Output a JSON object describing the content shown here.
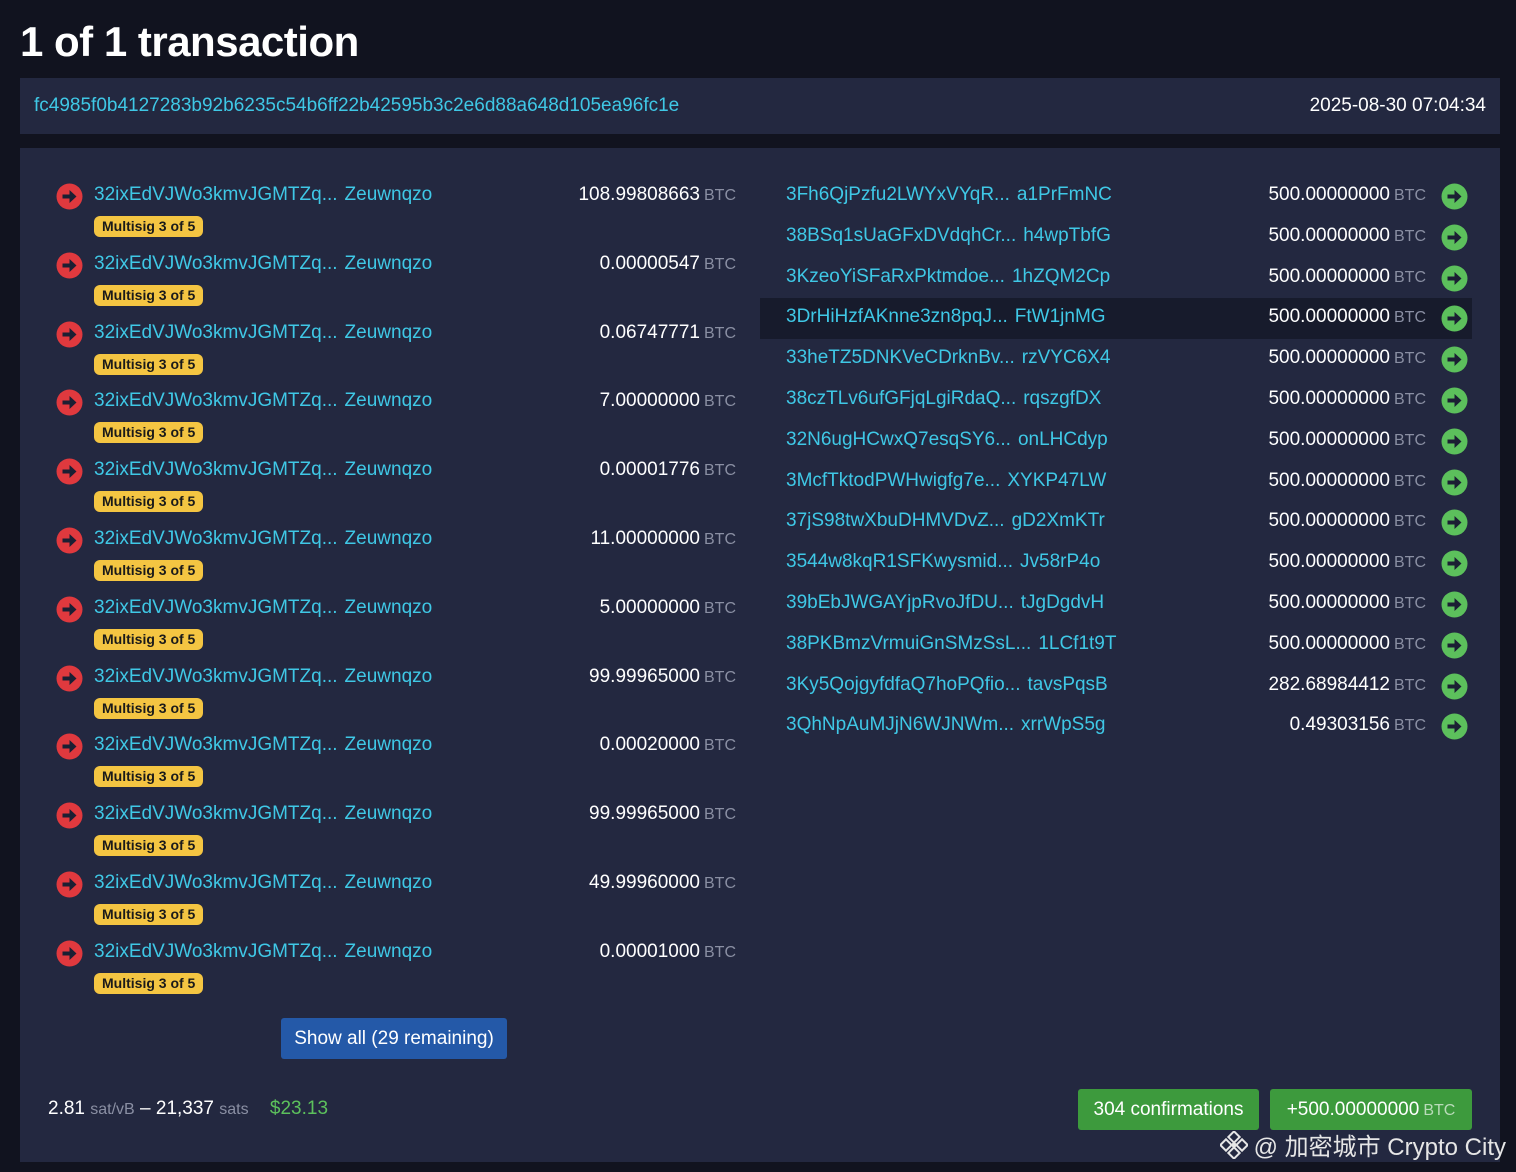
{
  "page": {
    "title": "1 of 1 transaction"
  },
  "transaction": {
    "txid": "fc4985f0b4127283b92b6235c54b6ff22b42595b3c2e6d88a648d105ea96fc1e",
    "timestamp": "2025-08-30 07:04:34"
  },
  "unit_label": "BTC",
  "colors": {
    "input_arrow": "#e0393e",
    "output_arrow": "#5cc05c",
    "link": "#3fc8e6",
    "badge": "#f4c542",
    "button_blue": "#2459a8",
    "button_green": "#3d9a3d"
  },
  "inputs": [
    {
      "address_head": "32ixEdVJWo3kmvJGMTZq...",
      "address_tail": "Zeuwnqzo",
      "badge": "Multisig 3 of 5",
      "amount": "108.99808663"
    },
    {
      "address_head": "32ixEdVJWo3kmvJGMTZq...",
      "address_tail": "Zeuwnqzo",
      "badge": "Multisig 3 of 5",
      "amount": "0.00000547"
    },
    {
      "address_head": "32ixEdVJWo3kmvJGMTZq...",
      "address_tail": "Zeuwnqzo",
      "badge": "Multisig 3 of 5",
      "amount": "0.06747771"
    },
    {
      "address_head": "32ixEdVJWo3kmvJGMTZq...",
      "address_tail": "Zeuwnqzo",
      "badge": "Multisig 3 of 5",
      "amount": "7.00000000"
    },
    {
      "address_head": "32ixEdVJWo3kmvJGMTZq...",
      "address_tail": "Zeuwnqzo",
      "badge": "Multisig 3 of 5",
      "amount": "0.00001776"
    },
    {
      "address_head": "32ixEdVJWo3kmvJGMTZq...",
      "address_tail": "Zeuwnqzo",
      "badge": "Multisig 3 of 5",
      "amount": "11.00000000"
    },
    {
      "address_head": "32ixEdVJWo3kmvJGMTZq...",
      "address_tail": "Zeuwnqzo",
      "badge": "Multisig 3 of 5",
      "amount": "5.00000000"
    },
    {
      "address_head": "32ixEdVJWo3kmvJGMTZq...",
      "address_tail": "Zeuwnqzo",
      "badge": "Multisig 3 of 5",
      "amount": "99.99965000"
    },
    {
      "address_head": "32ixEdVJWo3kmvJGMTZq...",
      "address_tail": "Zeuwnqzo",
      "badge": "Multisig 3 of 5",
      "amount": "0.00020000"
    },
    {
      "address_head": "32ixEdVJWo3kmvJGMTZq...",
      "address_tail": "Zeuwnqzo",
      "badge": "Multisig 3 of 5",
      "amount": "99.99965000"
    },
    {
      "address_head": "32ixEdVJWo3kmvJGMTZq...",
      "address_tail": "Zeuwnqzo",
      "badge": "Multisig 3 of 5",
      "amount": "49.99960000"
    },
    {
      "address_head": "32ixEdVJWo3kmvJGMTZq...",
      "address_tail": "Zeuwnqzo",
      "badge": "Multisig 3 of 5",
      "amount": "0.00001000"
    }
  ],
  "show_all_label": "Show all (29 remaining)",
  "outputs": [
    {
      "address_head": "3Fh6QjPzfu2LWYxVYqR...",
      "address_tail": "a1PrFmNC",
      "amount": "500.00000000"
    },
    {
      "address_head": "38BSq1sUaGFxDVdqhCr...",
      "address_tail": "h4wpTbfG",
      "amount": "500.00000000"
    },
    {
      "address_head": "3KzeoYiSFaRxPktmdoe...",
      "address_tail": "1hZQM2Cp",
      "amount": "500.00000000"
    },
    {
      "address_head": "3DrHiHzfAKnne3zn8pqJ...",
      "address_tail": "FtW1jnMG",
      "amount": "500.00000000",
      "highlighted": true
    },
    {
      "address_head": "33heTZ5DNKVeCDrknBv...",
      "address_tail": "rzVYC6X4",
      "amount": "500.00000000"
    },
    {
      "address_head": "38czTLv6ufGFjqLgiRdaQ...",
      "address_tail": "rqszgfDX",
      "amount": "500.00000000"
    },
    {
      "address_head": "32N6ugHCwxQ7esqSY6...",
      "address_tail": "onLHCdyp",
      "amount": "500.00000000"
    },
    {
      "address_head": "3McfTktodPWHwigfg7e...",
      "address_tail": "XYKP47LW",
      "amount": "500.00000000"
    },
    {
      "address_head": "37jS98twXbuDHMVDvZ...",
      "address_tail": "gD2XmKTr",
      "amount": "500.00000000"
    },
    {
      "address_head": "3544w8kqR1SFKwysmid...",
      "address_tail": "Jv58rP4o",
      "amount": "500.00000000"
    },
    {
      "address_head": "39bEbJWGAYjpRvoJfDU...",
      "address_tail": "tJgDgdvH",
      "amount": "500.00000000"
    },
    {
      "address_head": "38PKBmzVrmuiGnSMzSsL...",
      "address_tail": "1LCf1t9T",
      "amount": "500.00000000"
    },
    {
      "address_head": "3Ky5QojgyfdfaQ7hoPQfio...",
      "address_tail": "tavsPqsB",
      "amount": "282.68984412"
    },
    {
      "address_head": "3QhNpAuMJjN6WJNWm...",
      "address_tail": "xrrWpS5g",
      "amount": "0.49303156"
    }
  ],
  "footer": {
    "fee_rate": "2.81",
    "fee_rate_unit": "sat/vB",
    "separator": "–",
    "fee_sats": "21,337",
    "fee_sats_unit": "sats",
    "fee_fiat": "$23.13",
    "confirmations_label": "304 confirmations",
    "total_amount": "+500.00000000"
  },
  "watermark": {
    "text": "@ 加密城市 Crypto City"
  }
}
